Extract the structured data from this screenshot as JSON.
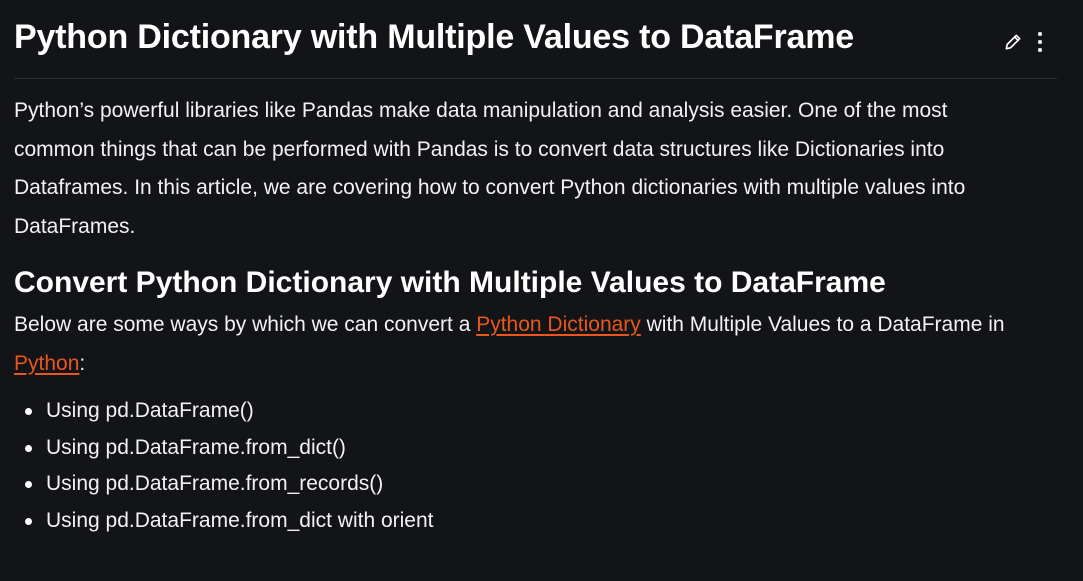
{
  "article": {
    "title": "Python Dictionary with Multiple Values to DataFrame",
    "intro": "Python’s powerful libraries like Pandas make data manipulation and analysis easier. One of the most common things that can be performed with Pandas is to convert data structures like Dictionaries into Dataframes. In this article, we are covering how to convert Python dictionaries with multiple values into DataFrames.",
    "section": {
      "heading": "Convert Python Dictionary with Multiple Values to DataFrame",
      "intro_part1": "Below are some ways by which we can convert a ",
      "link1": "Python Dictionary",
      "intro_part2": " with Multiple Values to a DataFrame in ",
      "link2": "Python",
      "intro_part3": ":",
      "methods": [
        "Using pd.DataFrame()",
        "Using pd.DataFrame.from_dict()",
        "Using pd.DataFrame.from_records()",
        "Using pd.DataFrame.from_dict with orient"
      ]
    }
  },
  "icons": {
    "edit": "pencil-icon",
    "more": "more-vertical-icon"
  },
  "colors": {
    "background": "#131417",
    "text": "#ffffff",
    "link": "#e8571c",
    "divider": "#2c2f34"
  }
}
